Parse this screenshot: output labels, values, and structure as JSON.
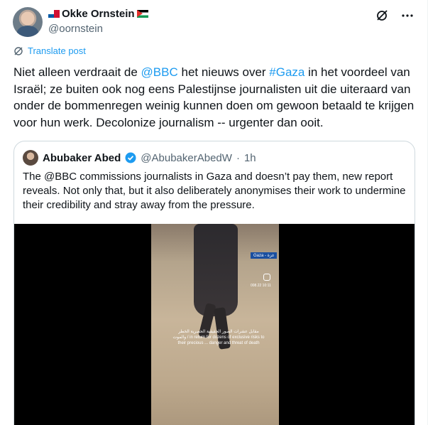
{
  "author": {
    "display_name": "Okke Ornstein",
    "handle": "@oornstein",
    "flags": [
      "panama-flag",
      "palestine-flag"
    ]
  },
  "actions": {
    "grok_icon": "slash-circle-icon",
    "more_icon": "more-icon"
  },
  "translate_label": "Translate post",
  "post": {
    "seg1": "Niet alleen verdraait de ",
    "mention": "@BBC",
    "seg2": " het nieuws over ",
    "hashtag": "#Gaza",
    "seg3": " in het voordeel van Israël; ze buiten ook nog eens Palestijnse journalisten uit die uiteraard van onder de bommenregen weinig kunnen doen om gewoon betaald te krijgen voor hun werk. Decolonize journalism -- urgenter dan ooit."
  },
  "quote": {
    "display_name": "Abubaker Abed",
    "handle": "@AbubakerAbedW",
    "separator": "·",
    "time": "1h",
    "text": "The @BBC commissions journalists in Gaza and doesn’t pay them, new report reveals. Not only that, but it also deliberately anonymises their work to undermine their credibility and stray away from the pressure.",
    "video": {
      "tag": "Gaza - غزة",
      "stamp": "008.22 10:11",
      "caption": "مقابل عشرات الصور الحقيقية الحصرية الخطر والموت / in return for dozens of exclusive risks to their precious ... danger and threat of death"
    }
  },
  "colors": {
    "link": "#1d9bf0",
    "text": "#0f1419",
    "muted": "#536471",
    "verified": "#1d9bf0"
  }
}
